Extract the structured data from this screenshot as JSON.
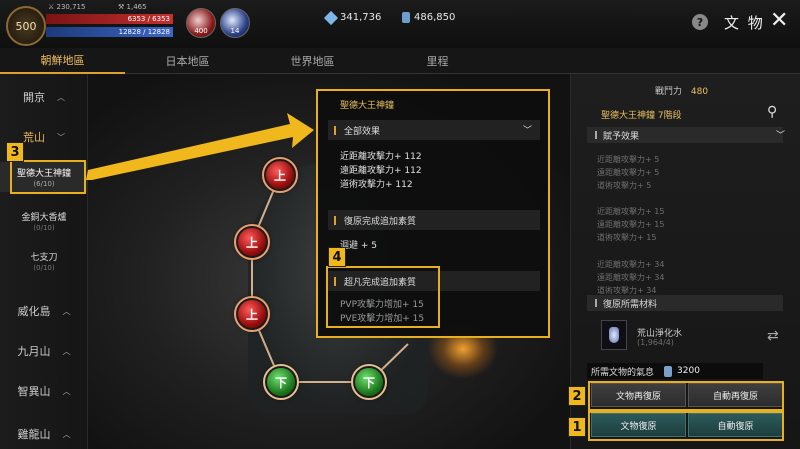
{
  "player": {
    "level": "500",
    "attack_stat": "230,715",
    "secondary_stat": "1,465",
    "hp": "6353 / 6353",
    "mp": "12828 / 12828",
    "potion_red_count": "400",
    "potion_blue_count": "14"
  },
  "currency": {
    "gems": "341,736",
    "crystals": "486,850"
  },
  "window_title": "文 物",
  "tabs": [
    "朝鮮地區",
    "日本地區",
    "世界地區",
    "里程"
  ],
  "active_tab": 0,
  "sidebar": {
    "regions": [
      "開京",
      "荒山",
      "威化島",
      "九月山",
      "智異山",
      "雞龍山"
    ],
    "items": [
      {
        "name": "聖德大王神鐘",
        "progress": "(6/10)"
      },
      {
        "name": "金銅大香爐",
        "progress": "(0/10)"
      },
      {
        "name": "七支刀",
        "progress": "(0/10)"
      }
    ]
  },
  "nodes": [
    "上",
    "上",
    "上",
    "下",
    "下"
  ],
  "popup": {
    "title": "聖德大王神鐘",
    "all_effects_label": "全部效果",
    "effects": [
      "近距離攻擊力+ 112",
      "遠距離攻擊力+ 112",
      "道術攻擊力+ 112"
    ],
    "restore_bonus_label": "復原完成追加素質",
    "restore_bonus": [
      "迴避 + 5"
    ],
    "transcend_label": "超凡完成追加素質",
    "transcend_bonus": [
      "PVP攻擊力增加+ 15",
      "PVE攻擊力增加+ 15"
    ]
  },
  "right_panel": {
    "combat_label": "戰鬥力",
    "combat_value": "480",
    "artifact_stage": "聖德大王神鐘 7階段",
    "grant_effect_label": "賦予效果",
    "effect_groups": [
      [
        "近距離攻擊力+ 5",
        "遠距離攻擊力+ 5",
        "道術攻擊力+ 5"
      ],
      [
        "近距離攻擊力+ 15",
        "遠距離攻擊力+ 15",
        "道術攻擊力+ 15"
      ],
      [
        "近距離攻擊力+ 34",
        "遠距離攻擊力+ 34",
        "道術攻擊力+ 34"
      ]
    ],
    "materials_label": "復原所需材料",
    "material_name": "荒山淨化水",
    "material_count": "(1,964/4)",
    "energy_label": "所需文物的氣息",
    "energy_value": "3200"
  },
  "buttons": {
    "re_restore": "文物再復原",
    "auto_re_restore": "自動再復原",
    "restore": "文物復原",
    "auto_restore": "自動復原"
  },
  "annotations": [
    "1",
    "2",
    "3",
    "4"
  ],
  "colors": {
    "highlight": "#e8b020",
    "accent_tab": "#f0c060",
    "hp": "#c43030",
    "mp": "#3c66c8"
  },
  "icons": {
    "help": "question-circle-icon",
    "close": "close-x-icon",
    "search": "magnifier-icon",
    "refresh": "cycle-arrows-icon"
  }
}
